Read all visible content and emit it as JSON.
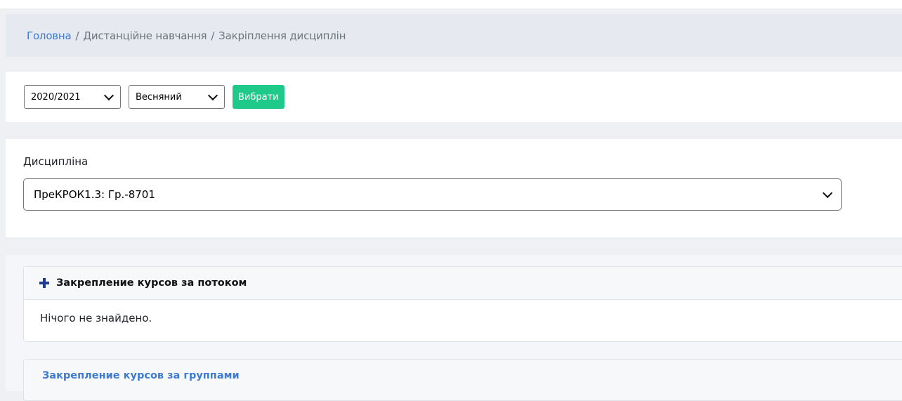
{
  "breadcrumb": {
    "home": "Головна",
    "separator": "/",
    "section": "Дистанційне навчання",
    "current": "Закріплення дисциплін"
  },
  "filters": {
    "year_value": "2020/2021",
    "semester_value": "Весняний",
    "submit_label": "Вибрати"
  },
  "discipline": {
    "label": "Дисципліна",
    "selected": "ПреКРОК1.3: Гр.-8701"
  },
  "stream_panel": {
    "icon": "plus-icon",
    "title": "Закрепление курсов за потоком",
    "empty_text": "Нічого не знайдено."
  },
  "groups_panel": {
    "title": "Закрепление курсов за группами"
  },
  "colors": {
    "link": "#3e7bd1",
    "success": "#1ec98a",
    "plus_icon": "#1f3b8f",
    "breadcrumb_bg": "#e6e9ef"
  }
}
